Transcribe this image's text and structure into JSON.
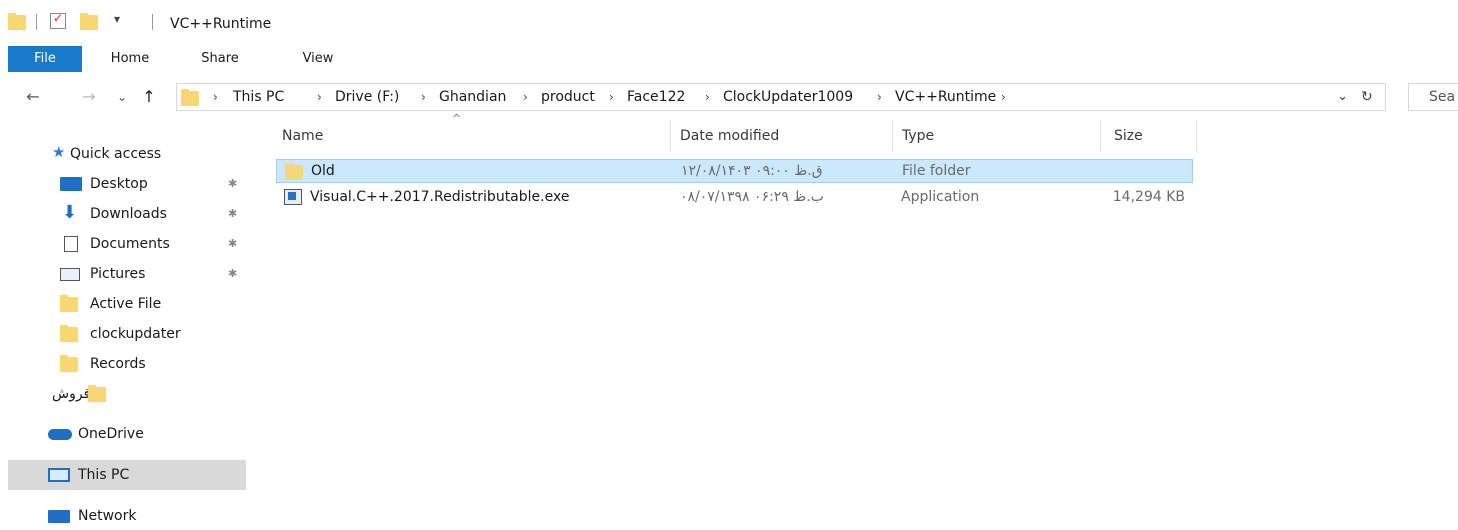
{
  "window": {
    "title": "VC++Runtime"
  },
  "ribbon": {
    "tabs": [
      {
        "label": "File"
      },
      {
        "label": "Home"
      },
      {
        "label": "Share"
      },
      {
        "label": "View"
      }
    ],
    "dropdown_glyph": "▾"
  },
  "nav_buttons": {
    "back": "←",
    "forward": "→",
    "recent": "⌄",
    "up": "↑"
  },
  "breadcrumb": {
    "items": [
      {
        "label": "This PC"
      },
      {
        "label": "Drive (F:)"
      },
      {
        "label": "Ghandian"
      },
      {
        "label": "product"
      },
      {
        "label": "Face122"
      },
      {
        "label": "ClockUpdater1009"
      },
      {
        "label": "VC++Runtime"
      }
    ],
    "separator": "›",
    "dropdown_glyph": "⌄",
    "refresh_glyph": "↻"
  },
  "search": {
    "text": "Sea"
  },
  "sidebar": {
    "items": [
      {
        "label": "Quick access",
        "icon": "star-icon",
        "pinned": false
      },
      {
        "label": "Desktop",
        "icon": "desktop-icon",
        "pinned": true
      },
      {
        "label": "Downloads",
        "icon": "download-icon",
        "pinned": true
      },
      {
        "label": "Documents",
        "icon": "document-icon",
        "pinned": true
      },
      {
        "label": "Pictures",
        "icon": "pictures-icon",
        "pinned": true
      },
      {
        "label": "Active File",
        "icon": "folder-icon",
        "pinned": false
      },
      {
        "label": "clockupdater",
        "icon": "folder-icon",
        "pinned": false
      },
      {
        "label": "Records",
        "icon": "folder-icon",
        "pinned": false
      },
      {
        "label": "فروش",
        "icon": "folder-icon",
        "pinned": false
      },
      {
        "label": "OneDrive",
        "icon": "cloud-icon",
        "pinned": false
      },
      {
        "label": "This PC",
        "icon": "computer-icon",
        "pinned": false,
        "selected": true
      },
      {
        "label": "Network",
        "icon": "network-icon",
        "pinned": false
      }
    ],
    "pin_glyph": "📌"
  },
  "file_list": {
    "columns": [
      {
        "label": "Name"
      },
      {
        "label": "Date modified"
      },
      {
        "label": "Type"
      },
      {
        "label": "Size"
      }
    ],
    "sort_glyph": "^",
    "rows": [
      {
        "name": "Old",
        "date": "۱۲/۰۸/۱۴۰۳ ق.ظ ۰۹:۰۰",
        "type": "File folder",
        "size": "",
        "icon": "folder-icon",
        "selected": true
      },
      {
        "name": "Visual.C++.2017.Redistributable.exe",
        "date": "۰۸/۰۷/۱۳۹۸ ب.ظ ۰۶:۲۹",
        "type": "Application",
        "size": "14,294 KB",
        "icon": "installer-icon",
        "selected": false
      }
    ]
  },
  "colors": {
    "accent": "#1979ca",
    "folder": "#f8d775",
    "selection": "#cce8ff",
    "nav_selected": "#d9d9d9"
  }
}
